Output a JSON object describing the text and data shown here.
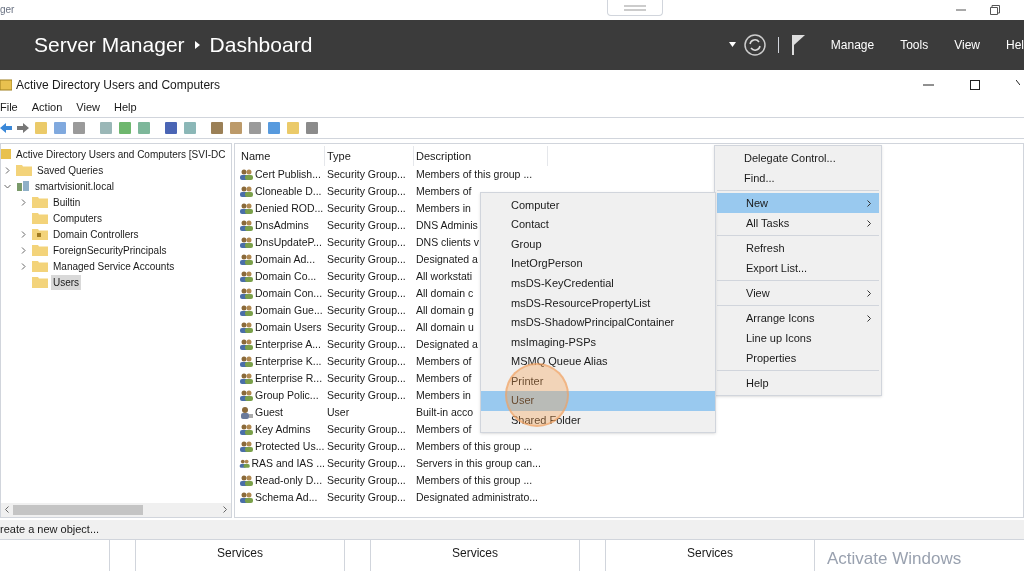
{
  "outer_window": {
    "title": "ger"
  },
  "server_manager": {
    "title": "Server Manager",
    "page": "Dashboard",
    "menu": [
      "Manage",
      "Tools",
      "View",
      "Hel"
    ]
  },
  "mmc_window": {
    "title": "Active Directory Users and Computers"
  },
  "menu_bar": [
    "File",
    "Action",
    "View",
    "Help"
  ],
  "tree": [
    {
      "label": "Active Directory Users and Computers [SVI-DC",
      "kind": "root",
      "selected": false,
      "children": [
        {
          "label": "Saved Queries",
          "kind": "folder",
          "expanded": false,
          "selected": false
        },
        {
          "label": "smartvisionit.local",
          "kind": "domain",
          "expanded": true,
          "selected": false,
          "children": [
            {
              "label": "Builtin",
              "kind": "folder",
              "expanded": false,
              "selected": false
            },
            {
              "label": "Computers",
              "kind": "folder",
              "selected": false
            },
            {
              "label": "Domain Controllers",
              "kind": "ou",
              "expanded": false,
              "selected": false
            },
            {
              "label": "ForeignSecurityPrincipals",
              "kind": "folder",
              "expanded": false,
              "selected": false
            },
            {
              "label": "Managed Service Accounts",
              "kind": "folder",
              "expanded": false,
              "selected": false
            },
            {
              "label": "Users",
              "kind": "folder",
              "selected": true
            }
          ]
        }
      ]
    }
  ],
  "table": {
    "columns": [
      "Name",
      "Type",
      "Description"
    ],
    "rows": [
      {
        "kind": "group",
        "name": "Cert Publish...",
        "type": "Security Group...",
        "description": "Members of this group ..."
      },
      {
        "kind": "group",
        "name": "Cloneable D...",
        "type": "Security Group...",
        "description": "Members of"
      },
      {
        "kind": "group",
        "name": "Denied ROD...",
        "type": "Security Group...",
        "description": "Members in"
      },
      {
        "kind": "group",
        "name": "DnsAdmins",
        "type": "Security Group...",
        "description": "DNS Adminis"
      },
      {
        "kind": "group",
        "name": "DnsUpdateP...",
        "type": "Security Group...",
        "description": "DNS clients v"
      },
      {
        "kind": "group",
        "name": "Domain Ad...",
        "type": "Security Group...",
        "description": "Designated a"
      },
      {
        "kind": "group",
        "name": "Domain Co...",
        "type": "Security Group...",
        "description": "All workstati"
      },
      {
        "kind": "group",
        "name": "Domain Con...",
        "type": "Security Group...",
        "description": "All domain c"
      },
      {
        "kind": "group",
        "name": "Domain Gue...",
        "type": "Security Group...",
        "description": "All domain g"
      },
      {
        "kind": "group",
        "name": "Domain Users",
        "type": "Security Group...",
        "description": "All domain u"
      },
      {
        "kind": "group",
        "name": "Enterprise A...",
        "type": "Security Group...",
        "description": "Designated a"
      },
      {
        "kind": "group",
        "name": "Enterprise K...",
        "type": "Security Group...",
        "description": "Members of"
      },
      {
        "kind": "group",
        "name": "Enterprise R...",
        "type": "Security Group...",
        "description": "Members of"
      },
      {
        "kind": "group",
        "name": "Group Polic...",
        "type": "Security Group...",
        "description": "Members in"
      },
      {
        "kind": "user",
        "name": "Guest",
        "type": "User",
        "description": "Built-in acco"
      },
      {
        "kind": "group",
        "name": "Key Admins",
        "type": "Security Group...",
        "description": "Members of"
      },
      {
        "kind": "group",
        "name": "Protected Us...",
        "type": "Security Group...",
        "description": "Members of this group ..."
      },
      {
        "kind": "group",
        "name": "RAS and IAS ...",
        "type": "Security Group...",
        "description": "Servers in this group can..."
      },
      {
        "kind": "group",
        "name": "Read-only D...",
        "type": "Security Group...",
        "description": "Members of this group ..."
      },
      {
        "kind": "group",
        "name": "Schema Ad...",
        "type": "Security Group...",
        "description": "Designated administrato..."
      }
    ]
  },
  "context_menu": [
    [
      {
        "label": "Delegate Control...",
        "submenu": false,
        "selected": false
      },
      {
        "label": "Find...",
        "submenu": false,
        "selected": false
      }
    ],
    [
      {
        "label": "New",
        "submenu": true,
        "selected": true
      },
      {
        "label": "All Tasks",
        "submenu": true,
        "selected": false
      }
    ],
    [
      {
        "label": "Refresh",
        "submenu": false,
        "selected": false
      },
      {
        "label": "Export List...",
        "submenu": false,
        "selected": false
      }
    ],
    [
      {
        "label": "View",
        "submenu": true,
        "selected": false
      }
    ],
    [
      {
        "label": "Arrange Icons",
        "submenu": true,
        "selected": false
      },
      {
        "label": "Line up Icons",
        "submenu": false,
        "selected": false
      },
      {
        "label": "Properties",
        "submenu": false,
        "selected": false
      }
    ],
    [
      {
        "label": "Help",
        "submenu": false,
        "selected": false
      }
    ]
  ],
  "new_submenu": [
    {
      "label": "Computer",
      "selected": false
    },
    {
      "label": "Contact",
      "selected": false
    },
    {
      "label": "Group",
      "selected": false
    },
    {
      "label": "InetOrgPerson",
      "selected": false
    },
    {
      "label": "msDS-KeyCredential",
      "selected": false
    },
    {
      "label": "msDS-ResourcePropertyList",
      "selected": false
    },
    {
      "label": "msDS-ShadowPrincipalContainer",
      "selected": false
    },
    {
      "label": "msImaging-PSPs",
      "selected": false
    },
    {
      "label": "MSMQ Queue Alias",
      "selected": false
    },
    {
      "label": "Printer",
      "selected": false
    },
    {
      "label": "User",
      "selected": true
    },
    {
      "label": "Shared Folder",
      "selected": false
    }
  ],
  "status_bar": "reate a new object...",
  "dashboard_tiles": [
    "Services",
    "Services",
    "Services"
  ],
  "activation_notice": "Activate Windows"
}
